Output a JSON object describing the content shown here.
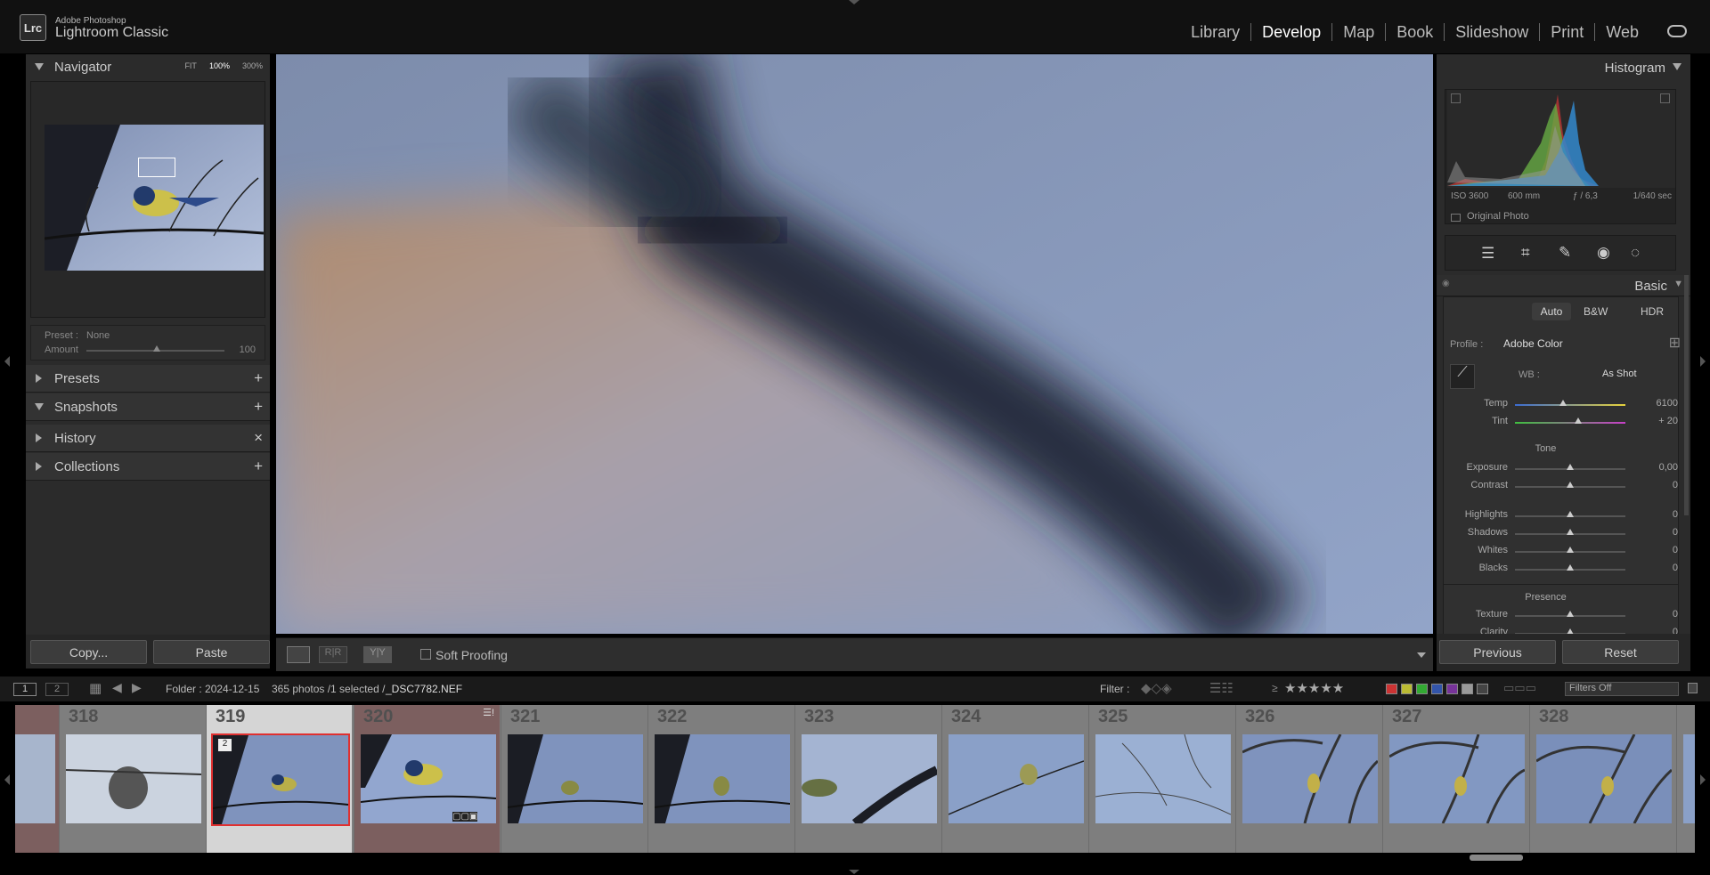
{
  "app": {
    "brand_line1": "Adobe Photoshop",
    "brand_line2": "Lightroom Classic",
    "logo": "Lrc"
  },
  "modules": [
    "Library",
    "Develop",
    "Map",
    "Book",
    "Slideshow",
    "Print",
    "Web"
  ],
  "active_module": "Develop",
  "left": {
    "navigator": "Navigator",
    "zoom": [
      "FIT",
      "100%",
      "300%"
    ],
    "preset_label": "Preset :",
    "preset_value": "None",
    "amount_label": "Amount",
    "amount_value": "100",
    "panels": [
      "Presets",
      "Snapshots",
      "History",
      "Collections"
    ],
    "copy": "Copy...",
    "paste": "Paste"
  },
  "toolbar": {
    "soft_proofing": "Soft Proofing"
  },
  "right": {
    "histogram": "Histogram",
    "iso": "ISO 3600",
    "focal": "600 mm",
    "aperture": "ƒ / 6,3",
    "shutter": "1/640 sec",
    "original": "Original Photo",
    "basic": "Basic",
    "auto": "Auto",
    "bw": "B&W",
    "hdr": "HDR",
    "profile_label": "Profile :",
    "profile_value": "Adobe Color",
    "wb_label": "WB :",
    "wb_value": "As Shot",
    "temp": {
      "label": "Temp",
      "value": "6100"
    },
    "tint": {
      "label": "Tint",
      "value": "+ 20"
    },
    "tone": "Tone",
    "exposure": {
      "label": "Exposure",
      "value": "0,00"
    },
    "contrast": {
      "label": "Contrast",
      "value": "0"
    },
    "highlights": {
      "label": "Highlights",
      "value": "0"
    },
    "shadows": {
      "label": "Shadows",
      "value": "0"
    },
    "whites": {
      "label": "Whites",
      "value": "0"
    },
    "blacks": {
      "label": "Blacks",
      "value": "0"
    },
    "presence": "Presence",
    "texture": {
      "label": "Texture",
      "value": "0"
    },
    "clarity": {
      "label": "Clarity",
      "value": "0"
    },
    "previous": "Previous",
    "reset": "Reset"
  },
  "filmbar": {
    "view1": "1",
    "view2": "2",
    "folder": "Folder : 2024-12-15",
    "count": "365 photos /1 selected /",
    "filename": "_DSC7782.NEF",
    "filter_label": "Filter :",
    "filter_value": "Filters Off",
    "rating_op": "≥"
  },
  "film": {
    "numbers": [
      "318",
      "319",
      "320",
      "321",
      "322",
      "323",
      "324",
      "325",
      "326",
      "327",
      "328"
    ],
    "badge": "2"
  },
  "colors": {
    "accent": "#ffffff",
    "selected_border": "#e03030",
    "panel": "#2b2b2b"
  }
}
